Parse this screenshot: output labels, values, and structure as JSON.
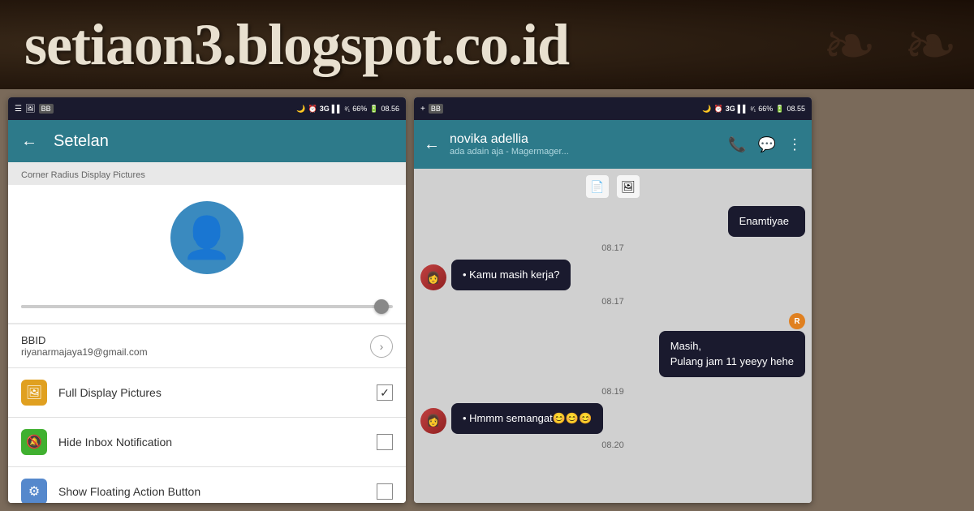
{
  "header": {
    "title": "setiaon3.blogspot.co.id"
  },
  "phone_left": {
    "status_bar": {
      "left_icons": [
        "☰",
        "🖼",
        "BB"
      ],
      "right_items": [
        "🌙",
        "⏰",
        "3G",
        "▌▌",
        "²⁄₁",
        "66%",
        "🔋",
        "08.56"
      ]
    },
    "app_bar": {
      "back_label": "←",
      "title": "Setelan"
    },
    "section_label": "Corner Radius Display Pictures",
    "bbid_label": "BBID",
    "bbid_value": "riyanarmajaya19@gmail.com",
    "menu_items": [
      {
        "icon": "🖼",
        "icon_color": "yellow",
        "label": "Full Display Pictures",
        "checked": true
      },
      {
        "icon": "🔕",
        "icon_color": "green",
        "label": "Hide Inbox Notification",
        "checked": false
      },
      {
        "icon": "⚙",
        "icon_color": "blue",
        "label": "Show Floating Action Button",
        "checked": false
      }
    ]
  },
  "phone_right": {
    "status_bar": {
      "right_items": [
        "🌙",
        "⏰",
        "3G",
        "▌▌",
        "²⁄₁",
        "66%",
        "🔋",
        "08.55"
      ]
    },
    "chat_header": {
      "back_label": "←",
      "contact_name": "novika adellia",
      "contact_status": "ada adain aja - Magermager...",
      "icons": [
        "📞",
        "💬",
        "⋮"
      ]
    },
    "messages": [
      {
        "type": "timestamp",
        "text": ""
      },
      {
        "type": "received_first",
        "text": "Enamtiyae",
        "time": ""
      },
      {
        "type": "timestamp",
        "text": "08.17"
      },
      {
        "type": "received",
        "text": "• Kamu masih kerja?",
        "time": "08.17"
      },
      {
        "type": "timestamp",
        "text": "08.17"
      },
      {
        "type": "sent",
        "sender_initial": "R",
        "text": "Masih,\nPulang jam 11 yeeyy hehe",
        "time": "08.17"
      },
      {
        "type": "timestamp",
        "text": "08.19"
      },
      {
        "type": "received",
        "text": "• Hmmm semangat😊😊😊",
        "time": "08.19"
      },
      {
        "type": "timestamp",
        "text": "08.20"
      }
    ]
  }
}
